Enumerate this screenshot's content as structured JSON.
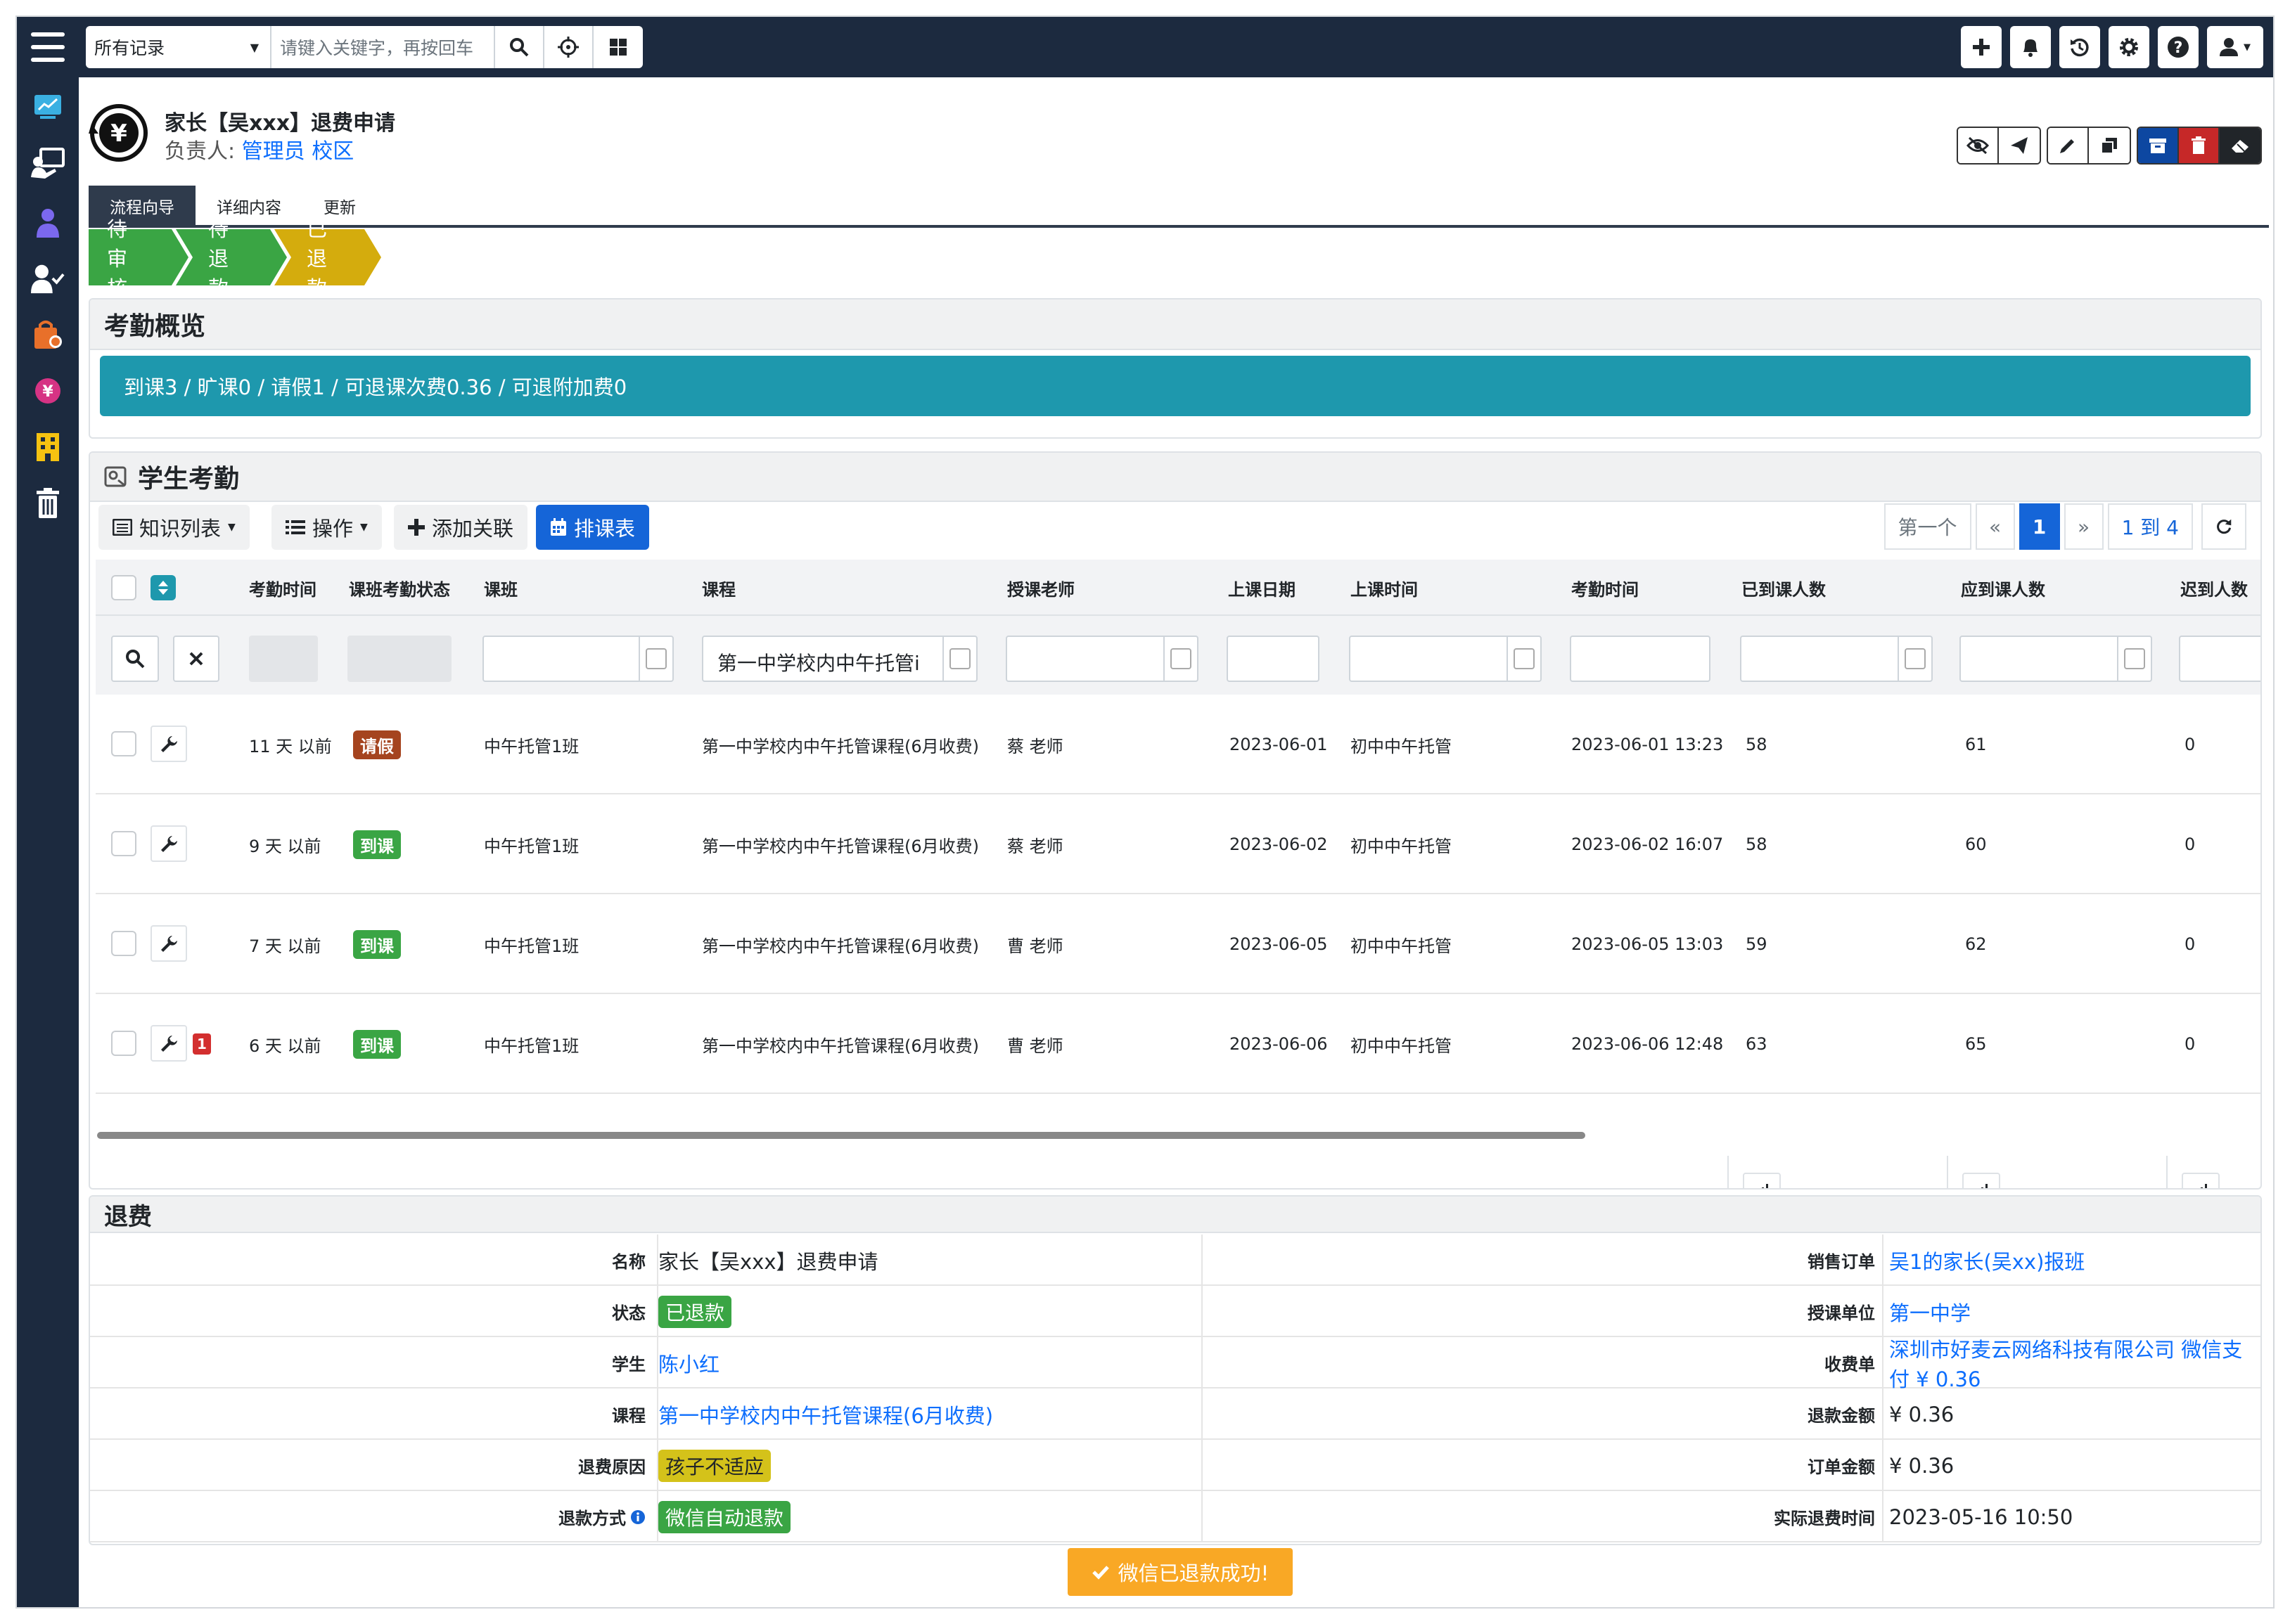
{
  "topbar": {
    "scope_select": "所有记录",
    "search_placeholder": "请键入关键字，再按回车"
  },
  "record": {
    "title": "家长【吴xxx】退费申请",
    "owner_label": "负责人:",
    "owner_name": "管理员",
    "owner_org": "校区"
  },
  "tabs": [
    "流程向导",
    "详细内容",
    "更新"
  ],
  "stages": [
    {
      "label": "待审核",
      "color": "#3aa544"
    },
    {
      "label": "待退款",
      "color": "#3aa544"
    },
    {
      "label": "已退款",
      "color": "#d4ac0d"
    }
  ],
  "overview": {
    "title": "考勤概览",
    "summary": "到课3 / 旷课0 / 请假1 / 可退课次费0.36 / 可退附加费0"
  },
  "attendance": {
    "title": "学生考勤",
    "toolbar": {
      "list": "知识列表",
      "ops": "操作",
      "add": "添加关联",
      "schedule": "排课表"
    },
    "pager": {
      "first": "第一个",
      "prev": "«",
      "page": "1",
      "next": "»",
      "range": "1 到 4"
    },
    "columns": [
      "考勤时间",
      "课班考勤状态",
      "课班",
      "课程",
      "授课老师",
      "上课日期",
      "上课时间",
      "考勤时间",
      "已到课人数",
      "应到课人数",
      "迟到人数"
    ],
    "filter_course": "第一中学校内中午托管i",
    "rows": [
      {
        "ago": "11 天 以前",
        "status": "请假",
        "status_color": "#a5441f",
        "class": "中午托管1班",
        "course": "第一中学校内中午托管课程(6月收费)",
        "teacher": "蔡 老师",
        "date": "2023-06-01",
        "time": "初中中午托管",
        "att_time": "2023-06-01 13:23",
        "arrived": "58",
        "expected": "61",
        "late": "0",
        "flag": ""
      },
      {
        "ago": "9 天 以前",
        "status": "到课",
        "status_color": "#3aa544",
        "class": "中午托管1班",
        "course": "第一中学校内中午托管课程(6月收费)",
        "teacher": "蔡 老师",
        "date": "2023-06-02",
        "time": "初中中午托管",
        "att_time": "2023-06-02 16:07",
        "arrived": "58",
        "expected": "60",
        "late": "0",
        "flag": ""
      },
      {
        "ago": "7 天 以前",
        "status": "到课",
        "status_color": "#3aa544",
        "class": "中午托管1班",
        "course": "第一中学校内中午托管课程(6月收费)",
        "teacher": "曹 老师",
        "date": "2023-06-05",
        "time": "初中中午托管",
        "att_time": "2023-06-05 13:03",
        "arrived": "59",
        "expected": "62",
        "late": "0",
        "flag": ""
      },
      {
        "ago": "6 天 以前",
        "status": "到课",
        "status_color": "#3aa544",
        "class": "中午托管1班",
        "course": "第一中学校内中午托管课程(6月收费)",
        "teacher": "曹 老师",
        "date": "2023-06-06",
        "time": "初中中午托管",
        "att_time": "2023-06-06 12:48",
        "arrived": "63",
        "expected": "65",
        "late": "0",
        "flag": "1"
      }
    ]
  },
  "refund": {
    "title": "退费",
    "left": [
      {
        "label": "名称",
        "value": "家长【吴xxx】退费申请",
        "kind": "text"
      },
      {
        "label": "状态",
        "value": "已退款",
        "kind": "badge",
        "color": "#3aa544"
      },
      {
        "label": "学生",
        "value": "陈小红",
        "kind": "link"
      },
      {
        "label": "课程",
        "value": "第一中学校内中午托管课程(6月收费)",
        "kind": "link"
      },
      {
        "label": "退费原因",
        "value": "孩子不适应",
        "kind": "badge-yellow",
        "color": "#d4c21a"
      },
      {
        "label": "退款方式",
        "value": "微信自动退款",
        "kind": "badge",
        "color": "#3aa544"
      }
    ],
    "right": [
      {
        "label": "销售订单",
        "value": "吴1的家长(吴xx)报班",
        "kind": "link"
      },
      {
        "label": "授课单位",
        "value": "第一中学",
        "kind": "link"
      },
      {
        "label": "收费单",
        "value": "深圳市好麦云网络科技有限公司 微信支付 ¥ 0.36",
        "kind": "link"
      },
      {
        "label": "退款金额",
        "value": "¥ 0.36",
        "kind": "text"
      },
      {
        "label": "订单金额",
        "value": "¥ 0.36",
        "kind": "text"
      },
      {
        "label": "实际退费时间",
        "value": "2023-05-16 10:50",
        "kind": "text"
      }
    ]
  },
  "toast": "微信已退款成功!"
}
